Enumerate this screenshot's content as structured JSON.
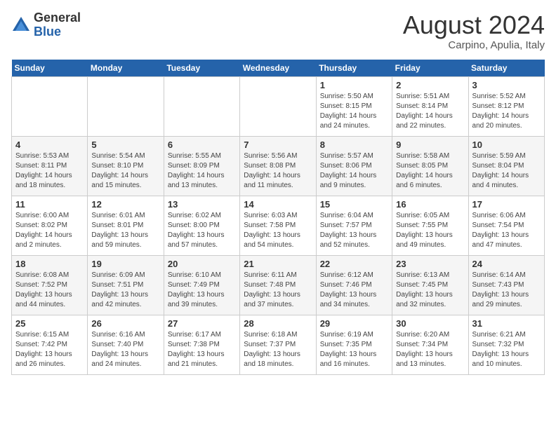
{
  "header": {
    "logo_general": "General",
    "logo_blue": "Blue",
    "month_title": "August 2024",
    "subtitle": "Carpino, Apulia, Italy"
  },
  "days_of_week": [
    "Sunday",
    "Monday",
    "Tuesday",
    "Wednesday",
    "Thursday",
    "Friday",
    "Saturday"
  ],
  "weeks": [
    [
      {
        "num": "",
        "info": ""
      },
      {
        "num": "",
        "info": ""
      },
      {
        "num": "",
        "info": ""
      },
      {
        "num": "",
        "info": ""
      },
      {
        "num": "1",
        "info": "Sunrise: 5:50 AM\nSunset: 8:15 PM\nDaylight: 14 hours and 24 minutes."
      },
      {
        "num": "2",
        "info": "Sunrise: 5:51 AM\nSunset: 8:14 PM\nDaylight: 14 hours and 22 minutes."
      },
      {
        "num": "3",
        "info": "Sunrise: 5:52 AM\nSunset: 8:12 PM\nDaylight: 14 hours and 20 minutes."
      }
    ],
    [
      {
        "num": "4",
        "info": "Sunrise: 5:53 AM\nSunset: 8:11 PM\nDaylight: 14 hours and 18 minutes."
      },
      {
        "num": "5",
        "info": "Sunrise: 5:54 AM\nSunset: 8:10 PM\nDaylight: 14 hours and 15 minutes."
      },
      {
        "num": "6",
        "info": "Sunrise: 5:55 AM\nSunset: 8:09 PM\nDaylight: 14 hours and 13 minutes."
      },
      {
        "num": "7",
        "info": "Sunrise: 5:56 AM\nSunset: 8:08 PM\nDaylight: 14 hours and 11 minutes."
      },
      {
        "num": "8",
        "info": "Sunrise: 5:57 AM\nSunset: 8:06 PM\nDaylight: 14 hours and 9 minutes."
      },
      {
        "num": "9",
        "info": "Sunrise: 5:58 AM\nSunset: 8:05 PM\nDaylight: 14 hours and 6 minutes."
      },
      {
        "num": "10",
        "info": "Sunrise: 5:59 AM\nSunset: 8:04 PM\nDaylight: 14 hours and 4 minutes."
      }
    ],
    [
      {
        "num": "11",
        "info": "Sunrise: 6:00 AM\nSunset: 8:02 PM\nDaylight: 14 hours and 2 minutes."
      },
      {
        "num": "12",
        "info": "Sunrise: 6:01 AM\nSunset: 8:01 PM\nDaylight: 13 hours and 59 minutes."
      },
      {
        "num": "13",
        "info": "Sunrise: 6:02 AM\nSunset: 8:00 PM\nDaylight: 13 hours and 57 minutes."
      },
      {
        "num": "14",
        "info": "Sunrise: 6:03 AM\nSunset: 7:58 PM\nDaylight: 13 hours and 54 minutes."
      },
      {
        "num": "15",
        "info": "Sunrise: 6:04 AM\nSunset: 7:57 PM\nDaylight: 13 hours and 52 minutes."
      },
      {
        "num": "16",
        "info": "Sunrise: 6:05 AM\nSunset: 7:55 PM\nDaylight: 13 hours and 49 minutes."
      },
      {
        "num": "17",
        "info": "Sunrise: 6:06 AM\nSunset: 7:54 PM\nDaylight: 13 hours and 47 minutes."
      }
    ],
    [
      {
        "num": "18",
        "info": "Sunrise: 6:08 AM\nSunset: 7:52 PM\nDaylight: 13 hours and 44 minutes."
      },
      {
        "num": "19",
        "info": "Sunrise: 6:09 AM\nSunset: 7:51 PM\nDaylight: 13 hours and 42 minutes."
      },
      {
        "num": "20",
        "info": "Sunrise: 6:10 AM\nSunset: 7:49 PM\nDaylight: 13 hours and 39 minutes."
      },
      {
        "num": "21",
        "info": "Sunrise: 6:11 AM\nSunset: 7:48 PM\nDaylight: 13 hours and 37 minutes."
      },
      {
        "num": "22",
        "info": "Sunrise: 6:12 AM\nSunset: 7:46 PM\nDaylight: 13 hours and 34 minutes."
      },
      {
        "num": "23",
        "info": "Sunrise: 6:13 AM\nSunset: 7:45 PM\nDaylight: 13 hours and 32 minutes."
      },
      {
        "num": "24",
        "info": "Sunrise: 6:14 AM\nSunset: 7:43 PM\nDaylight: 13 hours and 29 minutes."
      }
    ],
    [
      {
        "num": "25",
        "info": "Sunrise: 6:15 AM\nSunset: 7:42 PM\nDaylight: 13 hours and 26 minutes."
      },
      {
        "num": "26",
        "info": "Sunrise: 6:16 AM\nSunset: 7:40 PM\nDaylight: 13 hours and 24 minutes."
      },
      {
        "num": "27",
        "info": "Sunrise: 6:17 AM\nSunset: 7:38 PM\nDaylight: 13 hours and 21 minutes."
      },
      {
        "num": "28",
        "info": "Sunrise: 6:18 AM\nSunset: 7:37 PM\nDaylight: 13 hours and 18 minutes."
      },
      {
        "num": "29",
        "info": "Sunrise: 6:19 AM\nSunset: 7:35 PM\nDaylight: 13 hours and 16 minutes."
      },
      {
        "num": "30",
        "info": "Sunrise: 6:20 AM\nSunset: 7:34 PM\nDaylight: 13 hours and 13 minutes."
      },
      {
        "num": "31",
        "info": "Sunrise: 6:21 AM\nSunset: 7:32 PM\nDaylight: 13 hours and 10 minutes."
      }
    ]
  ]
}
